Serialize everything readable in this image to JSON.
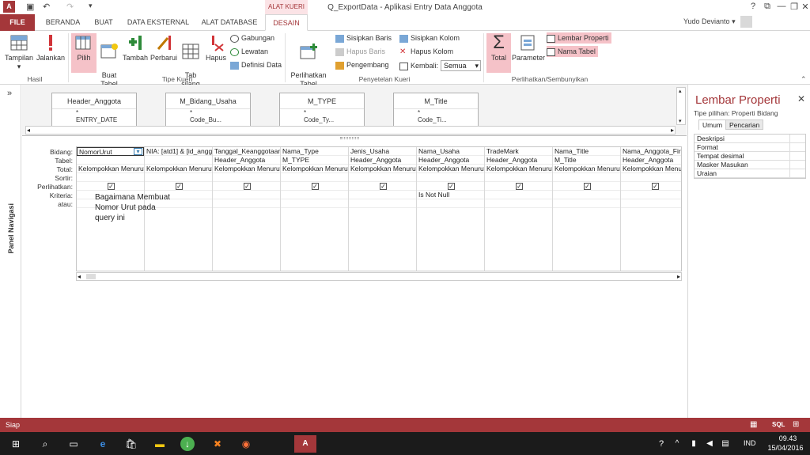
{
  "title_bar": {
    "window_title": "Q_ExportData - Aplikasi Entry Data Anggota",
    "contextual_group": "ALAT KUERI",
    "help": "?",
    "restore": "⧉",
    "minimize": "—",
    "maximize": "❐",
    "close": "✕"
  },
  "tabs": {
    "file": "FILE",
    "beranda": "BERANDA",
    "buat": "BUAT",
    "data_eksternal": "DATA EKSTERNAL",
    "alat_database": "ALAT DATABASE",
    "desain": "DESAIN"
  },
  "user": {
    "name": "Yudo Devianto",
    "chevron": "▾"
  },
  "ribbon": {
    "hasil": {
      "label": "Hasil",
      "tampilan": "Tampilan",
      "jalankan": "Jalankan"
    },
    "tipe_kueri": {
      "label": "Tipe Kueri",
      "pilih": "Pilih",
      "buat_tabel": "Buat\nTabel",
      "tambah": "Tambah",
      "perbarui": "Perbarui",
      "tab_silang": "Tab\nsilang",
      "hapus": "Hapus",
      "gabungan": "Gabungan",
      "lewatan": "Lewatan",
      "definisi_data": "Definisi Data"
    },
    "penyetelan": {
      "label": "Penyetelan Kueri",
      "perlihatkan_tabel": "Perlihatkan\nTabel",
      "sisipkan_baris": "Sisipkan Baris",
      "hapus_baris": "Hapus Baris",
      "pengembang": "Pengembang",
      "sisipkan_kolom": "Sisipkan Kolom",
      "hapus_kolom": "Hapus Kolom",
      "kembali": "Kembali:",
      "kembali_value": "Semua"
    },
    "perlihatkan": {
      "label": "Perlihatkan/Sembunyikan",
      "total": "Total",
      "parameter": "Parameter",
      "lembar_properti": "Lembar Properti",
      "nama_tabel": "Nama Tabel"
    }
  },
  "nav_pane": {
    "label": "Panel Navigasi",
    "toggle": "»"
  },
  "tables": [
    {
      "name": "Header_Anggota",
      "first": "*",
      "second": "ENTRY_DATE"
    },
    {
      "name": "M_Bidang_Usaha",
      "first": "*",
      "second": "Code_Bu..."
    },
    {
      "name": "M_TYPE",
      "first": "*",
      "second": "Code_Ty..."
    },
    {
      "name": "M_Title",
      "first": "*",
      "second": "Code_Ti..."
    }
  ],
  "grid": {
    "row_labels": [
      "Bidang:",
      "Tabel:",
      "Total:",
      "Sortir:",
      "Perlihatkan:",
      "Kriteria:",
      "atau:"
    ],
    "columns": [
      {
        "bidang": "NomorUrut",
        "tabel": "",
        "total": "Kelompokkan Menurut",
        "show": true,
        "kriteria": ""
      },
      {
        "bidang": "NIA: [atd1] & [id_anggota]",
        "tabel": "",
        "total": "Kelompokkan Menurut",
        "show": true,
        "kriteria": ""
      },
      {
        "bidang": "Tanggal_Keanggotaan",
        "tabel": "Header_Anggota",
        "total": "Kelompokkan Menurut",
        "show": true,
        "kriteria": ""
      },
      {
        "bidang": "Nama_Type",
        "tabel": "M_TYPE",
        "total": "Kelompokkan Menurut",
        "show": true,
        "kriteria": ""
      },
      {
        "bidang": "Jenis_Usaha",
        "tabel": "Header_Anggota",
        "total": "Kelompokkan Menurut",
        "show": true,
        "kriteria": ""
      },
      {
        "bidang": "Nama_Usaha",
        "tabel": "Header_Anggota",
        "total": "Kelompokkan Menurut",
        "show": true,
        "kriteria": "Is Not Null"
      },
      {
        "bidang": "TradeMark",
        "tabel": "Header_Anggota",
        "total": "Kelompokkan Menurut",
        "show": true,
        "kriteria": ""
      },
      {
        "bidang": "Nama_Title",
        "tabel": "M_Title",
        "total": "Kelompokkan Menurut",
        "show": true,
        "kriteria": ""
      },
      {
        "bidang": "Nama_Anggota_First",
        "tabel": "Header_Anggota",
        "total": "Kelompokkan Menurut",
        "show": true,
        "kriteria": ""
      }
    ],
    "note": "Bagaimana Membuat\nNomor Urut pada\nquery ini"
  },
  "property_sheet": {
    "title": "Lembar Properti",
    "close": "✕",
    "selection_type": "Tipe pilihan:  Properti Bidang",
    "tab_umum": "Umum",
    "tab_pencarian": "Pencarian",
    "rows": [
      "Deskripsi",
      "Format",
      "Tempat desimal",
      "Masker Masukan",
      "Uraian"
    ]
  },
  "status": {
    "text": "Siap"
  },
  "taskbar": {
    "time": "09.43",
    "date": "15/04/2016",
    "lang": "IND"
  },
  "colors": {
    "accent": "#a4373a",
    "active_button": "#f5c2c8"
  }
}
